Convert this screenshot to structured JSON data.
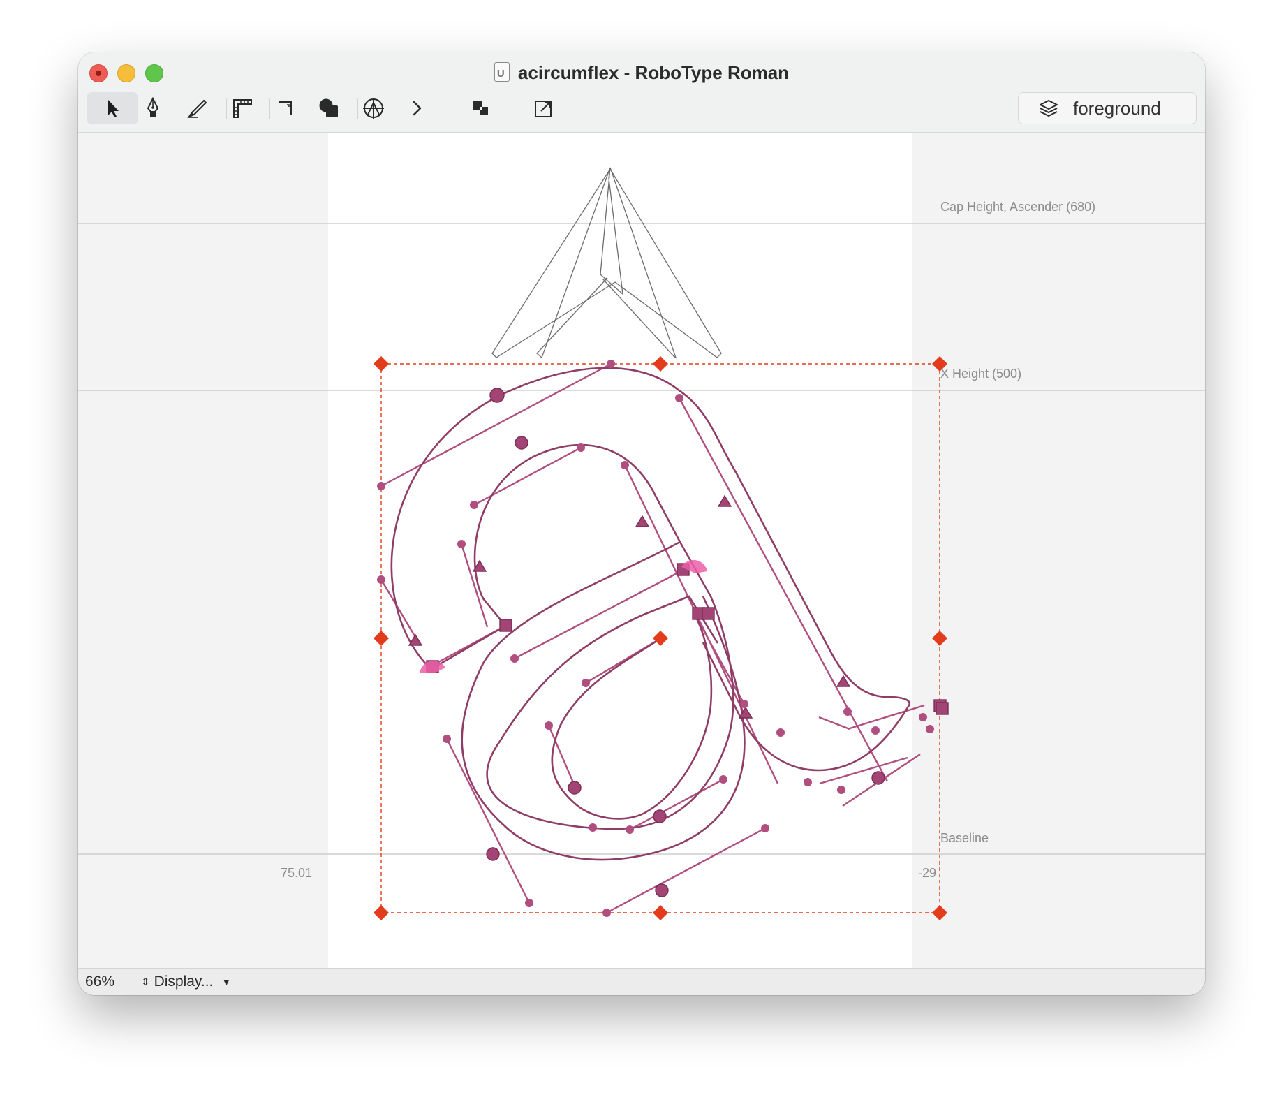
{
  "window": {
    "title": "acircumflex - RoboType Roman",
    "file_icon": "ufo-document-icon"
  },
  "toolbar": {
    "tools": [
      {
        "name": "editing-tool",
        "icon": "arrow-pointer-icon",
        "active": true
      },
      {
        "name": "bezier-tool",
        "icon": "pen-nib-icon",
        "active": false
      },
      {
        "name": "slice-tool",
        "icon": "knife-icon",
        "active": false
      },
      {
        "name": "measurement-tool",
        "icon": "ruler-icon",
        "active": false
      },
      {
        "name": "shape-tool",
        "icon": "corner-icon",
        "active": false
      },
      {
        "name": "remove-overlap",
        "icon": "overlap-icon",
        "active": false
      },
      {
        "name": "add-anchor",
        "icon": "anchor-icon",
        "active": false
      },
      {
        "name": "more-tools",
        "icon": "chevron-right-icon",
        "active": false
      },
      {
        "name": "layers-view",
        "icon": "stacked-squares-icon",
        "active": false
      },
      {
        "name": "export",
        "icon": "export-box-icon",
        "active": false
      }
    ],
    "layer": "foreground"
  },
  "metrics": {
    "cap_height": "Cap Height, Ascender (680)",
    "x_height": "X Height (500)",
    "baseline": "Baseline",
    "left_sidebearing": "75.01",
    "right_sidebearing": "-29"
  },
  "status": {
    "zoom": "66%",
    "display": "Display..."
  },
  "colors": {
    "contour": "#8f3d66",
    "point": "#b04f7f",
    "selection": "#e23c1d",
    "start_point": "#ec5fa8"
  }
}
